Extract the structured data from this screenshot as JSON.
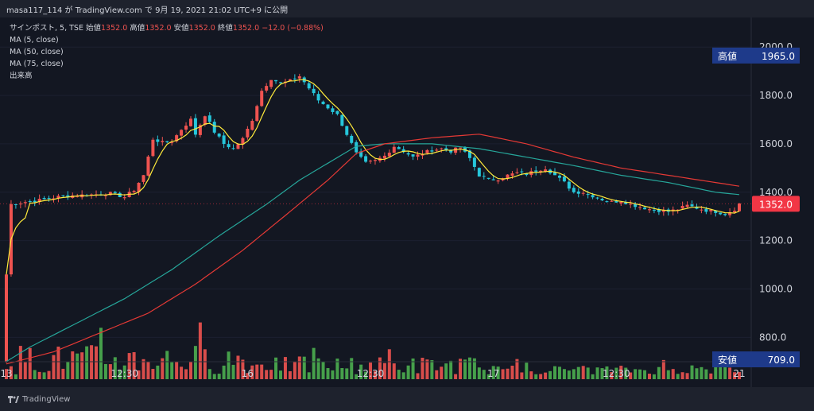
{
  "header": {
    "publisher_line": "masa117_114 が TradingView.com で 9月 19, 2021 21:02 UTC+9 に公開"
  },
  "legend": {
    "symbol": "サインポスト, 5, TSE",
    "open_label": "始値",
    "open_value": "1352.0",
    "high_label": "高値",
    "high_value": "1352.0",
    "low_label": "安値",
    "low_value": "1352.0",
    "close_label": "終値",
    "close_value": "1352.0",
    "change": "−12.0 (−0.88%)",
    "ma5": "MA (5, close)",
    "ma50": "MA (50, close)",
    "ma75": "MA (75, close)",
    "volume": "出来高"
  },
  "colors": {
    "up": "#ef5350",
    "down": "#26c6da",
    "volume_up": "#ef5350",
    "volume_down": "#4caf50",
    "ma5": "#ffeb3b",
    "ma50": "#26a69a",
    "ma75": "#e53935",
    "label_blue": "#1e3a8a",
    "price_tag": "#f23645"
  },
  "chart_data": {
    "type": "candlestick",
    "ylim": [
      650,
      2050
    ],
    "y_ticks": [
      "2000.0",
      "1800.0",
      "1600.0",
      "1400.0",
      "1200.0",
      "1000.0",
      "800.0"
    ],
    "y_tick_values": [
      2000,
      1800,
      1600,
      1400,
      1200,
      1000,
      800
    ],
    "x_ticks": [
      "13",
      "12:30",
      "16",
      "12:30",
      "17",
      "12:30",
      "21"
    ],
    "x_tick_index": [
      0,
      25,
      51,
      77,
      103,
      129,
      155
    ],
    "bars_total": 156,
    "high_marker": {
      "label": "高値",
      "value": "1965.0",
      "y": 1965
    },
    "low_marker": {
      "label": "安値",
      "value": "709.0",
      "y": 709
    },
    "last_price": {
      "value": "1352.0",
      "y": 1352
    },
    "close_anchors": [
      [
        0,
        1060
      ],
      [
        1,
        1350
      ],
      [
        4,
        1360
      ],
      [
        8,
        1370
      ],
      [
        12,
        1385
      ],
      [
        18,
        1390
      ],
      [
        22,
        1395
      ],
      [
        25,
        1380
      ],
      [
        27,
        1410
      ],
      [
        29,
        1470
      ],
      [
        31,
        1620
      ],
      [
        33,
        1605
      ],
      [
        35,
        1610
      ],
      [
        37,
        1660
      ],
      [
        39,
        1700
      ],
      [
        40,
        1640
      ],
      [
        42,
        1720
      ],
      [
        44,
        1650
      ],
      [
        46,
        1600
      ],
      [
        48,
        1580
      ],
      [
        50,
        1620
      ],
      [
        52,
        1700
      ],
      [
        54,
        1820
      ],
      [
        56,
        1870
      ],
      [
        58,
        1850
      ],
      [
        60,
        1860
      ],
      [
        62,
        1880
      ],
      [
        64,
        1830
      ],
      [
        66,
        1780
      ],
      [
        68,
        1750
      ],
      [
        70,
        1720
      ],
      [
        72,
        1640
      ],
      [
        74,
        1560
      ],
      [
        76,
        1520
      ],
      [
        78,
        1530
      ],
      [
        80,
        1550
      ],
      [
        82,
        1590
      ],
      [
        84,
        1570
      ],
      [
        86,
        1545
      ],
      [
        88,
        1560
      ],
      [
        90,
        1575
      ],
      [
        92,
        1580
      ],
      [
        94,
        1570
      ],
      [
        96,
        1585
      ],
      [
        98,
        1540
      ],
      [
        100,
        1470
      ],
      [
        102,
        1450
      ],
      [
        104,
        1455
      ],
      [
        106,
        1470
      ],
      [
        108,
        1480
      ],
      [
        110,
        1475
      ],
      [
        112,
        1490
      ],
      [
        114,
        1500
      ],
      [
        116,
        1470
      ],
      [
        118,
        1440
      ],
      [
        120,
        1400
      ],
      [
        122,
        1400
      ],
      [
        124,
        1385
      ],
      [
        126,
        1370
      ],
      [
        128,
        1360
      ],
      [
        130,
        1365
      ],
      [
        132,
        1350
      ],
      [
        134,
        1340
      ],
      [
        136,
        1330
      ],
      [
        138,
        1325
      ],
      [
        140,
        1320
      ],
      [
        142,
        1330
      ],
      [
        144,
        1345
      ],
      [
        146,
        1335
      ],
      [
        148,
        1325
      ],
      [
        150,
        1320
      ],
      [
        152,
        1310
      ],
      [
        154,
        1330
      ],
      [
        155,
        1352
      ]
    ],
    "ma50_anchors": [
      [
        0,
        700
      ],
      [
        5,
        760
      ],
      [
        15,
        860
      ],
      [
        25,
        960
      ],
      [
        35,
        1080
      ],
      [
        45,
        1220
      ],
      [
        55,
        1350
      ],
      [
        62,
        1450
      ],
      [
        68,
        1520
      ],
      [
        74,
        1590
      ],
      [
        80,
        1600
      ],
      [
        90,
        1600
      ],
      [
        100,
        1580
      ],
      [
        110,
        1545
      ],
      [
        120,
        1510
      ],
      [
        130,
        1470
      ],
      [
        140,
        1440
      ],
      [
        150,
        1400
      ],
      [
        155,
        1390
      ]
    ],
    "ma75_anchors": [
      [
        0,
        690
      ],
      [
        10,
        740
      ],
      [
        20,
        820
      ],
      [
        30,
        900
      ],
      [
        40,
        1020
      ],
      [
        50,
        1160
      ],
      [
        60,
        1320
      ],
      [
        68,
        1450
      ],
      [
        74,
        1560
      ],
      [
        80,
        1600
      ],
      [
        90,
        1625
      ],
      [
        100,
        1640
      ],
      [
        110,
        1600
      ],
      [
        120,
        1545
      ],
      [
        130,
        1500
      ],
      [
        140,
        1470
      ],
      [
        150,
        1440
      ],
      [
        155,
        1425
      ]
    ],
    "volume_hint": "bars along bottom, taller in first two sessions"
  }
}
